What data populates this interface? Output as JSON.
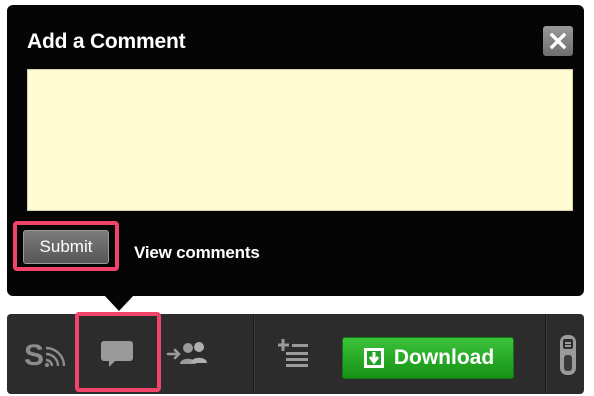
{
  "popup": {
    "title": "Add a Comment",
    "close_icon": "close-icon",
    "comment_value": "",
    "submit_label": "Submit",
    "view_comments_label": "View comments"
  },
  "toolbar": {
    "items": [
      "share-icon",
      "comment-icon",
      "add-friends-icon",
      "add-to-list-icon",
      "download-button",
      "remote-icon"
    ],
    "download_label": "Download"
  },
  "colors": {
    "popup_bg": "#050505",
    "comment_bg": "#fffbd2",
    "highlight": "#f0446a",
    "download_green": "#22a322",
    "toolbar_bg": "#2c2c2c"
  }
}
